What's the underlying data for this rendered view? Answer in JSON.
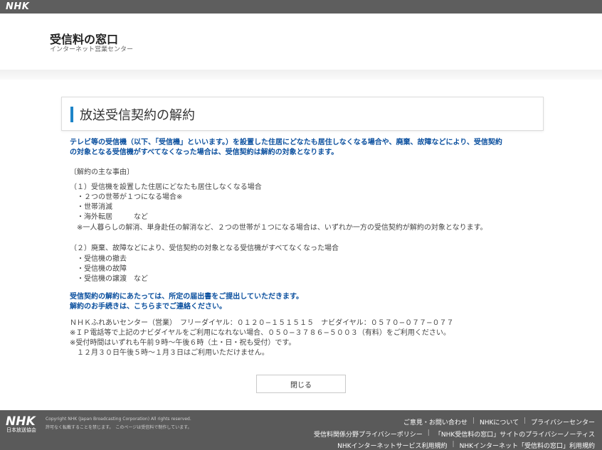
{
  "topbar": {
    "logo": "NHK"
  },
  "header": {
    "title": "受信料の窓口",
    "subtitle": "インターネット営業センター"
  },
  "page": {
    "heading": "放送受信契約の解約"
  },
  "intro": {
    "line1": "テレビ等の受信機（以下、「受信機」といいます。）を設置した住居にどなたも居住しなくなる場合や、廃棄、故障などにより、受信契約",
    "line2": "の対象となる受信機がすべてなくなった場合は、受信契約は解約の対象となります。"
  },
  "reasons": {
    "title": "〔解約の主な事由〕",
    "r1": "（１）受信機を設置した住居にどなたも居住しなくなる場合",
    "r1_items": [
      "・２つの世帯が１つになる場合※",
      "・世帯消滅",
      "・海外転居　　　など"
    ],
    "r1_note": "※一人暮らしの解消、単身赴任の解消など、２つの世帯が１つになる場合は、いずれか一方の受信契約が解約の対象となります。",
    "r2": "（２）廃棄、故障などにより、受信契約の対象となる受信機がすべてなくなった場合",
    "r2_items": [
      "・受信機の撤去",
      "・受信機の故障",
      "・受信機の譲渡　など"
    ]
  },
  "notice": {
    "line1": "受信契約の解約にあたっては、所定の届出書をご提出していただきます。",
    "line2": "解約のお手続きは、こちらまでご連絡ください。"
  },
  "contact": {
    "line1": "ＮＨＫふれあいセンター（営業）　フリーダイヤル：０１２０−１５１５１５　ナビダイヤル：０５７０−０７７−０７７",
    "line2": "※ＩＰ電話等で上記のナビダイヤルをご利用になれない場合、０５０−３７８６−５００３（有料）をご利用ください。",
    "line3": "※受付時間はいずれも午前９時〜午後６時（土・日・祝も受付）です。",
    "line4": "　１２月３０日午後５時〜１月３日はご利用いただけません。"
  },
  "close_button": "閉じる",
  "footer": {
    "logo": "NHK",
    "logo_sub": "日本放送協会",
    "copyright1": "Copyright NHK (Japan Broadcasting Corporation) All rights reserved.",
    "copyright2": "許可なく転載することを禁じます。　このページは受信料で制作しています。",
    "links_row1": [
      "ご意見・お問い合わせ",
      "NHKについて",
      "プライバシーセンター"
    ],
    "links_row2": [
      "受信料関係分野プライバシーポリシー",
      "「NHK受信料の窓口」サイトのプライバシーノーティス"
    ],
    "links_row3": [
      "NHKインターネットサービス利用規約",
      "NHKインターネット「受信料の窓口」利用規約"
    ]
  }
}
